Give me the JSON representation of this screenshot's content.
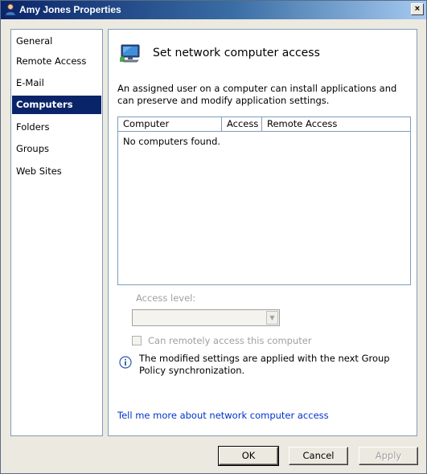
{
  "window": {
    "title": "Amy Jones Properties",
    "close_glyph": "×"
  },
  "nav": {
    "items": [
      {
        "label": "General",
        "selected": false
      },
      {
        "label": "Remote Access",
        "selected": false
      },
      {
        "label": "E-Mail",
        "selected": false
      },
      {
        "label": "Computers",
        "selected": true
      },
      {
        "label": "Folders",
        "selected": false
      },
      {
        "label": "Groups",
        "selected": false
      },
      {
        "label": "Web Sites",
        "selected": false
      }
    ]
  },
  "content": {
    "heading": "Set network computer access",
    "header_icon": "network-computer-icon",
    "description": "An assigned user on a computer can install applications and can preserve and modify application settings.",
    "table": {
      "columns": [
        "Computer",
        "Access",
        "Remote Access"
      ],
      "rows": [],
      "empty_text": "No computers found."
    },
    "access_level_label": "Access level:",
    "access_level_value": "",
    "remote_checkbox_label": "Can remotely access this computer",
    "remote_checkbox_checked": false,
    "info_text": "The modified settings are applied with the next Group Policy synchronization.",
    "help_link": "Tell me more about network computer access"
  },
  "buttons": {
    "ok": "OK",
    "cancel": "Cancel",
    "apply": "Apply"
  },
  "colors": {
    "selection": "#0a246a",
    "link": "#0033cc",
    "disabled": "#a0a0a0"
  }
}
